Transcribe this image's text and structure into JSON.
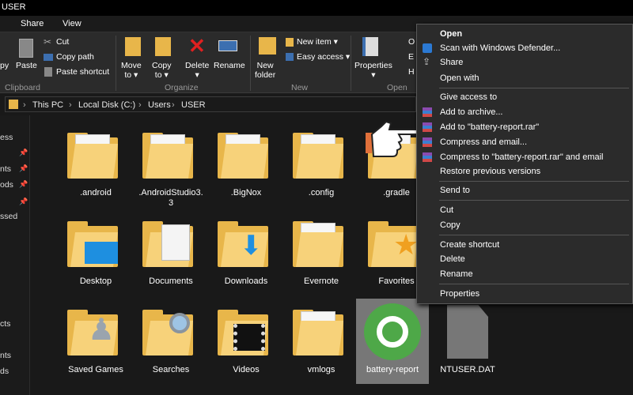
{
  "window": {
    "title": "USER"
  },
  "tabs": [
    "Share",
    "View"
  ],
  "ribbon": {
    "clipboard": {
      "label": "Clipboard",
      "copy_partial": "py",
      "paste": "Paste",
      "cut": "Cut",
      "copy_path": "Copy path",
      "paste_shortcut": "Paste shortcut"
    },
    "organize": {
      "label": "Organize",
      "move_to": "Move\nto ▾",
      "copy_to": "Copy\nto ▾",
      "delete": "Delete\n▾",
      "rename": "Rename"
    },
    "new": {
      "label": "New",
      "new_folder": "New\nfolder",
      "new_item": "New item ▾",
      "easy_access": "Easy access ▾"
    },
    "open": {
      "label": "Open",
      "properties": "Properties\n▾",
      "o_partial": "O",
      "e_partial": "E",
      "h_partial": "H"
    }
  },
  "address": {
    "breadcrumb": [
      "This PC",
      "Local Disk (C:)",
      "Users",
      "USER"
    ],
    "separator": "›"
  },
  "nav": {
    "items": [
      "ess",
      "nts",
      "ods",
      "ssed",
      "cts",
      "nts",
      "ds"
    ]
  },
  "files": [
    {
      "name": ".android",
      "type": "folder-doc"
    },
    {
      "name": ".AndroidStudio3.\n3",
      "type": "folder-doc"
    },
    {
      "name": ".BigNox",
      "type": "folder-doc"
    },
    {
      "name": ".config",
      "type": "folder-doc"
    },
    {
      "name": ".gradle",
      "type": "folder-doc"
    },
    {
      "name": "Desktop",
      "type": "folder-desktop"
    },
    {
      "name": "Documents",
      "type": "folder-documents"
    },
    {
      "name": "Downloads",
      "type": "folder-downloads"
    },
    {
      "name": "Evernote",
      "type": "folder-doc"
    },
    {
      "name": "Favorites",
      "type": "folder-favorites"
    },
    {
      "name": "Saved Games",
      "type": "folder-games"
    },
    {
      "name": "Searches",
      "type": "folder-search"
    },
    {
      "name": "Videos",
      "type": "folder-videos"
    },
    {
      "name": "vmlogs",
      "type": "folder-doc"
    },
    {
      "name": "battery-report",
      "type": "coccoc-file"
    },
    {
      "name": "NTUSER.DAT",
      "type": "file"
    }
  ],
  "context_menu": {
    "items": [
      {
        "label": "Open",
        "bold": true
      },
      {
        "label": "Scan with Windows Defender...",
        "icon": "defender-icon"
      },
      {
        "label": "Share",
        "icon": "share-icon"
      },
      {
        "label": "Open with"
      },
      {
        "label": "Give access to"
      },
      {
        "label": "Add to archive...",
        "icon": "winrar-icon"
      },
      {
        "label": "Add to \"battery-report.rar\"",
        "icon": "winrar-icon"
      },
      {
        "label": "Compress and email...",
        "icon": "winrar-icon"
      },
      {
        "label": "Compress to \"battery-report.rar\" and email",
        "icon": "winrar-icon"
      },
      {
        "label": "Restore previous versions"
      },
      {
        "label": "Send to"
      },
      {
        "label": "Cut"
      },
      {
        "label": "Copy"
      },
      {
        "label": "Create shortcut"
      },
      {
        "label": "Delete"
      },
      {
        "label": "Rename"
      },
      {
        "label": "Properties"
      }
    ]
  },
  "colors": {
    "folder": "#e8b64a",
    "menu_bg": "#2b2b2b",
    "selected": "#777777",
    "accent": "#2b79d3"
  }
}
